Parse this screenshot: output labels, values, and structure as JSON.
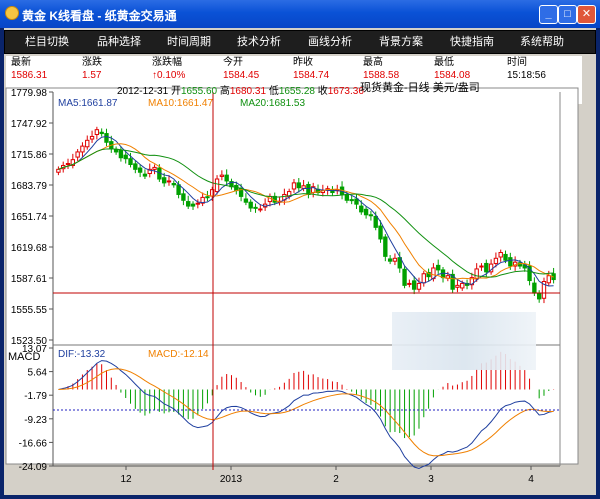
{
  "window": {
    "title": "黄金  K线看盘  -  纸黄金交易通",
    "minimize": "_",
    "maximize": "□",
    "close": "✕"
  },
  "menu": [
    {
      "label": "栏目切换"
    },
    {
      "label": "品种选择"
    },
    {
      "label": "时间周期"
    },
    {
      "label": "技术分析"
    },
    {
      "label": "画线分析"
    },
    {
      "label": "背景方案"
    },
    {
      "label": "快捷指南"
    },
    {
      "label": "系统帮助"
    }
  ],
  "quote": [
    {
      "label": "最新",
      "value": "1586.31"
    },
    {
      "label": "涨跌",
      "value": "1.57"
    },
    {
      "label": "涨跌幅",
      "value": "↑0.10%"
    },
    {
      "label": "今开",
      "value": "1584.45"
    },
    {
      "label": "昨收",
      "value": "1584.74"
    },
    {
      "label": "最高",
      "value": "1588.58"
    },
    {
      "label": "最低",
      "value": "1584.08"
    },
    {
      "label": "时间",
      "value": "15:18:56"
    }
  ],
  "colors": {
    "up": "#e00000",
    "down": "#00a000",
    "ma5": "#1f3f9f",
    "ma10": "#f08000",
    "ma20": "#109010",
    "dif": "#1f3f9f",
    "dea": "#f08000"
  },
  "chart_data": {
    "type": "candlestick",
    "title": "现货黄金-日线 美元/盎司",
    "crosshair": {
      "date": "2012-12-31",
      "open_label": "开",
      "open": "1655.60",
      "high_label": "高",
      "high": "1680.31",
      "low_label": "低",
      "low": "1655.28",
      "close_label": "收",
      "close": "1673.36"
    },
    "ma": [
      {
        "name": "MA5",
        "value": "1661.87"
      },
      {
        "name": "MA10",
        "value": "1661.47"
      },
      {
        "name": "MA20",
        "value": "1681.53"
      }
    ],
    "price_axis": [
      "1779.98",
      "1747.92",
      "1715.86",
      "1683.79",
      "1651.74",
      "1619.68",
      "1587.61",
      "1555.55",
      "1523.50"
    ],
    "ylim": [
      1523.5,
      1779.98
    ],
    "macd_label": "MACD",
    "macd_axis": [
      "13.07",
      "5.64",
      "-1.79",
      "-9.23",
      "-16.66",
      "-24.09"
    ],
    "macd_ylim": [
      -24.09,
      13.07
    ],
    "dif_label": "DIF:-13.32",
    "dea_label": "MACD:-12.14",
    "x_ticks": [
      "12",
      "2013",
      "2",
      "3",
      "4"
    ],
    "closes": [
      1700,
      1704,
      1706,
      1710,
      1718,
      1724,
      1730,
      1734,
      1741,
      1737,
      1728,
      1722,
      1718,
      1712,
      1711,
      1705,
      1700,
      1697,
      1693,
      1700,
      1702,
      1690,
      1686,
      1688,
      1684,
      1674,
      1668,
      1662,
      1662,
      1665,
      1671,
      1671,
      1679,
      1690,
      1694,
      1688,
      1682,
      1678,
      1672,
      1666,
      1660,
      1660,
      1659,
      1664,
      1672,
      1666,
      1667,
      1674,
      1677,
      1686,
      1681,
      1683,
      1674,
      1682,
      1676,
      1678,
      1680,
      1676,
      1679,
      1674,
      1668,
      1668,
      1664,
      1656,
      1653,
      1652,
      1640,
      1628,
      1610,
      1605,
      1608,
      1598,
      1580,
      1582,
      1576,
      1582,
      1592,
      1589,
      1598,
      1596,
      1588,
      1590,
      1576,
      1580,
      1582,
      1580,
      1588,
      1597,
      1600,
      1594,
      1602,
      1608,
      1614,
      1606,
      1600,
      1604,
      1600,
      1598,
      1585,
      1572,
      1566,
      1584,
      1590,
      1586
    ]
  }
}
